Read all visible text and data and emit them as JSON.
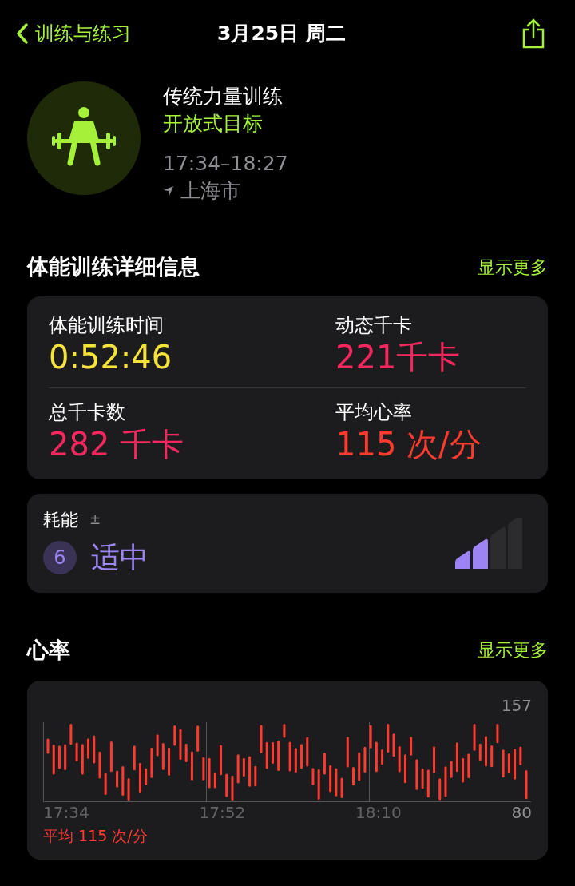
{
  "nav": {
    "back_label": "训练与练习",
    "title": "3月25日 周二"
  },
  "workout": {
    "name": "传统力量训练",
    "goal": "开放式目标",
    "time": "17:34–18:27",
    "location": "上海市"
  },
  "details": {
    "title": "体能训练详细信息",
    "more": "显示更多",
    "metrics": [
      {
        "label": "体能训练时间",
        "value": "0:52:46",
        "color": "#f5e23a"
      },
      {
        "label": "动态千卡",
        "value": "221千卡",
        "color": "#f6275f"
      },
      {
        "label": "总千卡数",
        "value": "282 千卡",
        "color": "#f6275f"
      },
      {
        "label": "平均心率",
        "value": "115 次/分",
        "color": "#ff3b30"
      }
    ]
  },
  "effort": {
    "label": "耗能",
    "info": "±",
    "score": "6",
    "rating": "适中",
    "level": 0.5
  },
  "heart_rate": {
    "title": "心率",
    "more": "显示更多",
    "y_max": "157",
    "y_min": "80",
    "x_labels": [
      "17:34",
      "17:52",
      "18:10"
    ],
    "average": "平均 115 次/分"
  }
}
